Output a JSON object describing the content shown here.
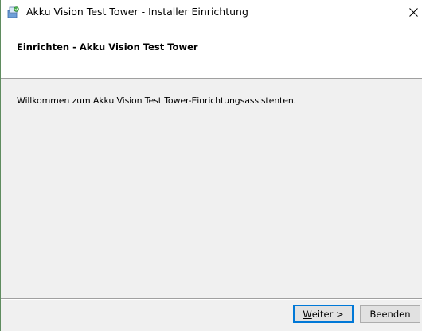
{
  "window": {
    "title": "Akku Vision Test Tower - Installer Einrichtung",
    "close_icon": "close-icon",
    "app_icon": "installer-icon"
  },
  "header": {
    "title": "Einrichten - Akku Vision Test Tower"
  },
  "content": {
    "welcome_text": "Willkommen zum Akku Vision Test Tower-Einrichtungsassistenten."
  },
  "footer": {
    "next_mnemonic": "W",
    "next_rest": "eiter >",
    "cancel_label": "Beenden"
  },
  "colors": {
    "focus_border": "#0078d7",
    "dialog_bg": "#f0f0f0",
    "header_bg": "#ffffff"
  }
}
